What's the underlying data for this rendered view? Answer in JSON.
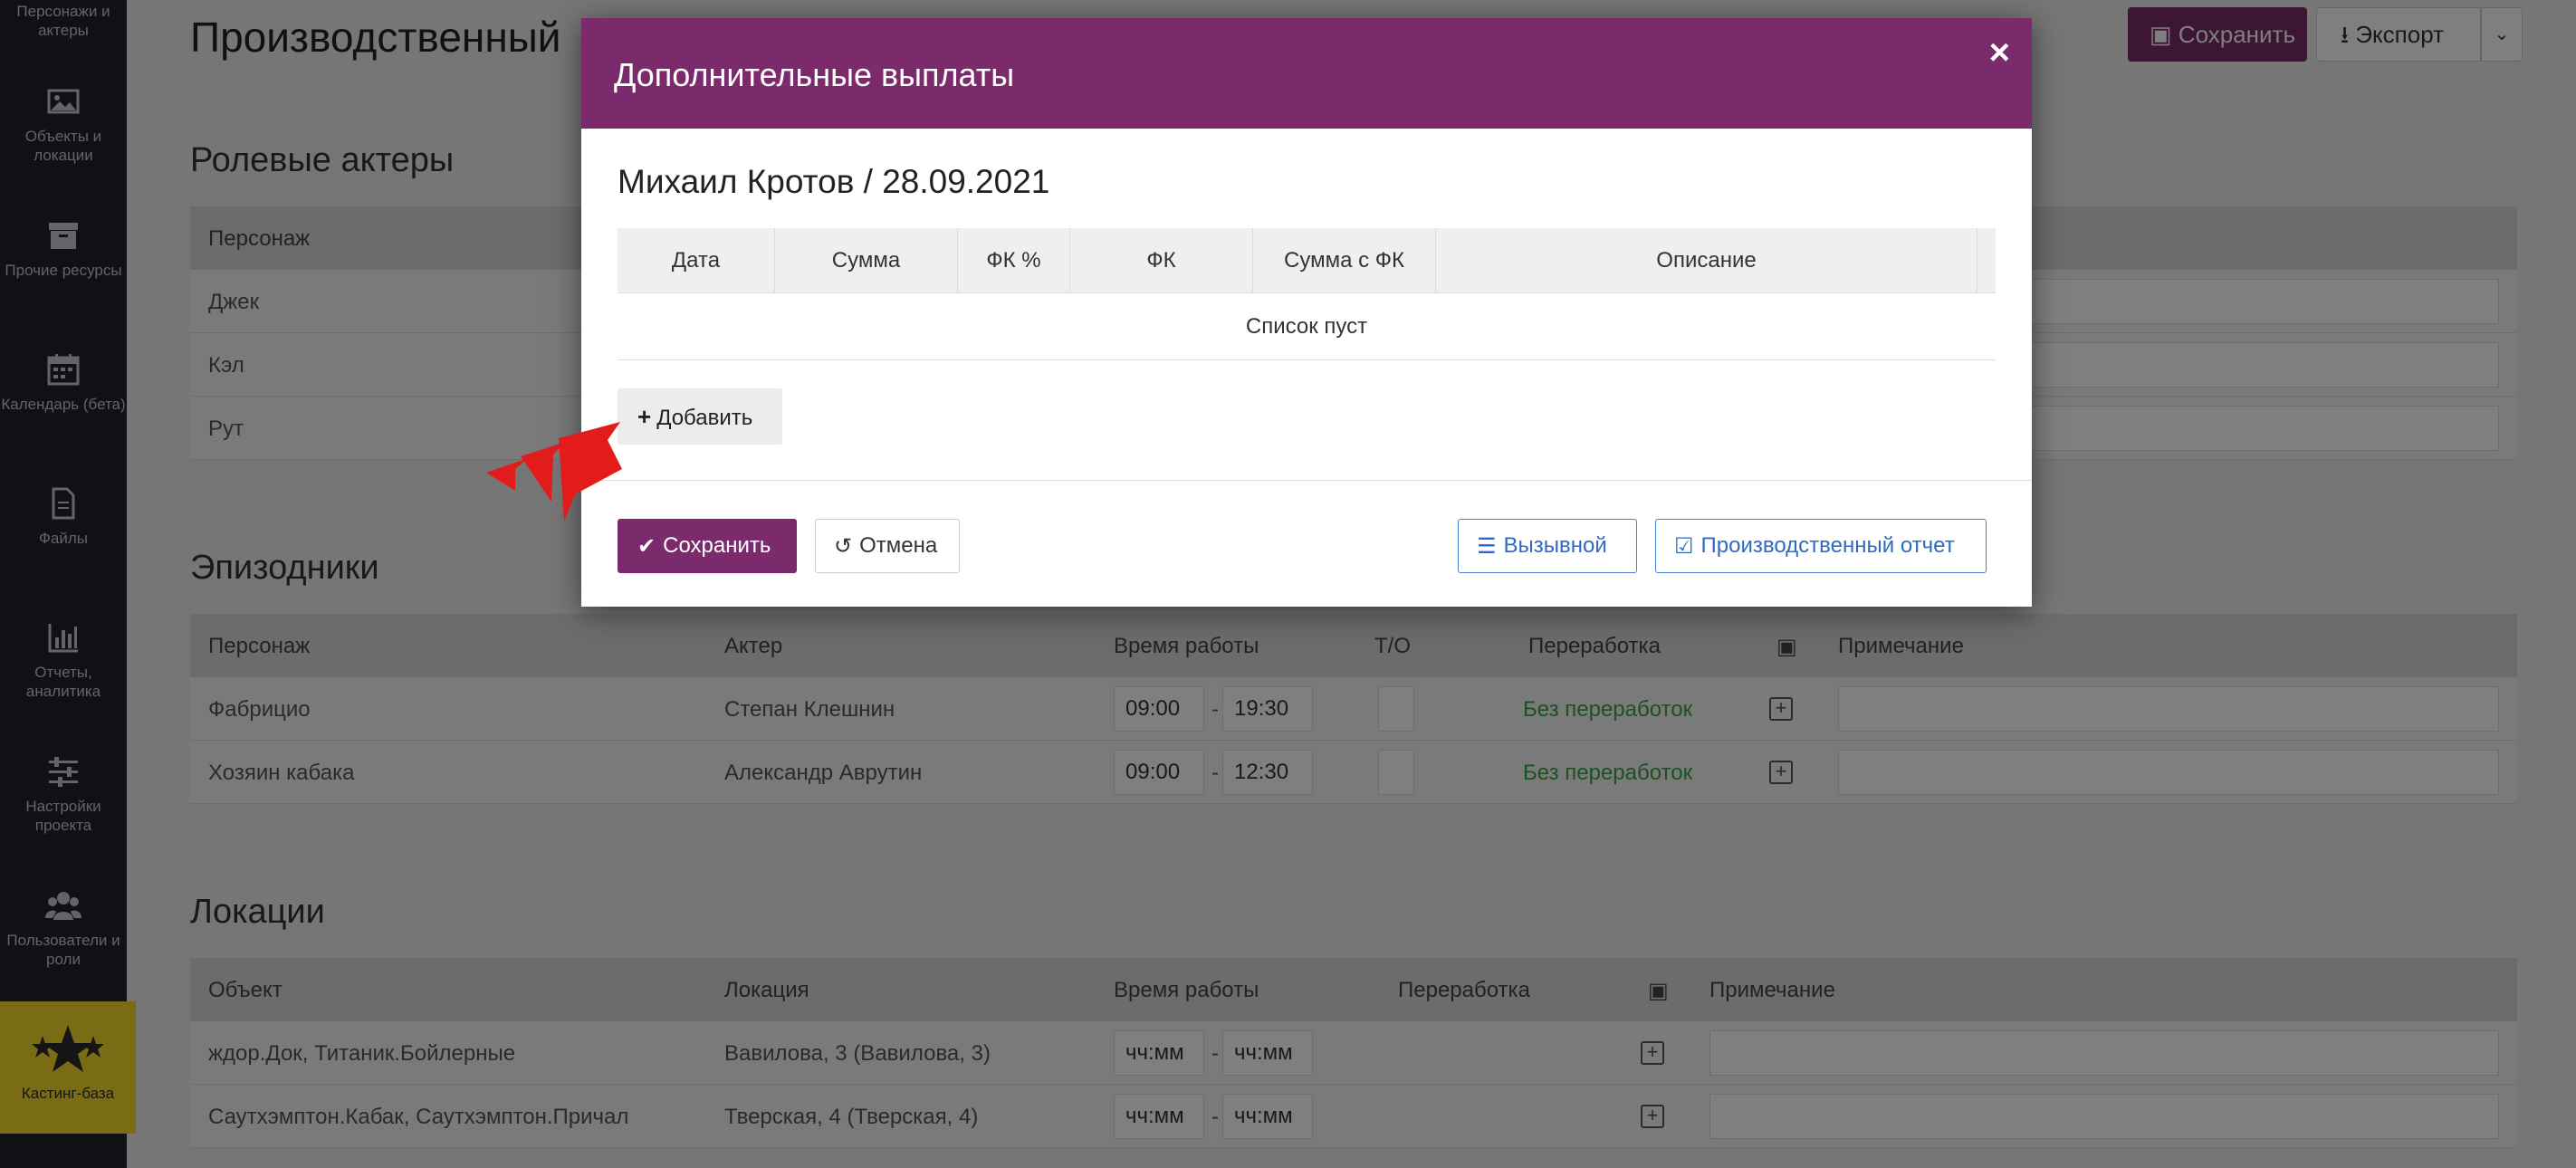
{
  "sidebar": {
    "items": [
      {
        "label": "Персонажи и актеры",
        "icon": "users-icon"
      },
      {
        "label": "Объекты и локации",
        "icon": "image-icon"
      },
      {
        "label": "Прочие ресурсы",
        "icon": "archive-icon"
      },
      {
        "label": "Календарь (бета)",
        "icon": "calendar-icon"
      },
      {
        "label": "Файлы",
        "icon": "file-icon"
      },
      {
        "label": "Отчеты, аналитика",
        "icon": "bar-chart-icon"
      },
      {
        "label": "Настройки проекта",
        "icon": "sliders-icon"
      },
      {
        "label": "Пользователи и роли",
        "icon": "group-icon"
      }
    ],
    "casting": {
      "label": "Кастинг-база",
      "icon": "stars-icon"
    }
  },
  "page": {
    "title": "Производственный",
    "toolbar": {
      "save_label": "Сохранить",
      "export_label": "Экспорт"
    },
    "roles": {
      "title": "Ролевые актеры",
      "header": {
        "character": "Персонаж"
      },
      "rows": [
        {
          "character": "Джек"
        },
        {
          "character": "Кэл"
        },
        {
          "character": "Рут"
        }
      ]
    },
    "extras": {
      "title": "Эпизодники",
      "header": {
        "character": "Персонаж",
        "actor": "Актер",
        "work_time": "Время работы",
        "to": "Т/О",
        "overtime": "Переработка",
        "note": "Примечание"
      },
      "rows": [
        {
          "character": "Фабрицио",
          "actor": "Степан Клешнин",
          "start": "09:00",
          "end": "19:30",
          "overtime": "Без переработок"
        },
        {
          "character": "Хозяин кабака",
          "actor": "Александр Аврутин",
          "start": "09:00",
          "end": "12:30",
          "overtime": "Без переработок"
        }
      ]
    },
    "locations": {
      "title": "Локации",
      "header": {
        "object": "Объект",
        "location": "Локация",
        "work_time": "Время работы",
        "overtime": "Переработка",
        "note": "Примечание"
      },
      "rows": [
        {
          "object": "ждор.Док, Титаник.Бойлерные",
          "location": "Вавилова, 3 (Вавилова, 3)",
          "start": "чч:мм",
          "end": "чч:мм"
        },
        {
          "object": "Саутхэмптон.Кабак, Саутхэмптон.Причал",
          "location": "Тверская, 4 (Тверская, 4)",
          "start": "чч:мм",
          "end": "чч:мм"
        }
      ]
    }
  },
  "modal": {
    "title": "Дополнительные выплаты",
    "close": "×",
    "person": "Михаил Кротов / 28.09.2021",
    "table": {
      "columns": [
        "Дата",
        "Сумма",
        "ФК %",
        "ФК",
        "Сумма с ФК",
        "Описание"
      ],
      "empty": "Список пуст"
    },
    "add_label": "Добавить",
    "footer": {
      "save_label": "Сохранить",
      "cancel_label": "Отмена",
      "call_label": "Вызывной",
      "report_label": "Производственный отчет"
    }
  },
  "colors": {
    "brand": "#7b2a6b",
    "link": "#2f6ac3",
    "ok": "#3aa047",
    "casting": "#f5d829"
  }
}
